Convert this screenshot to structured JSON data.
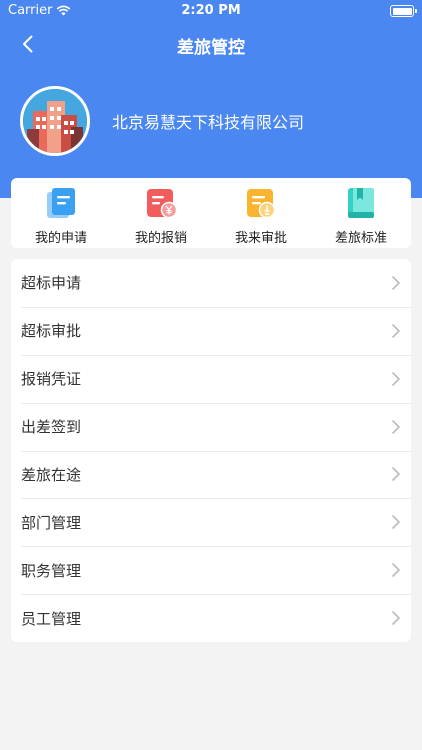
{
  "status_bar": {
    "carrier": "Carrier",
    "time": "2:20 PM"
  },
  "nav": {
    "title": "差旅管控"
  },
  "profile": {
    "company": "北京易慧天下科技有限公司"
  },
  "quick_actions": [
    {
      "label": "我的申请",
      "icon": "application-doc-icon",
      "color": "#3aa0f4"
    },
    {
      "label": "我的报销",
      "icon": "reimbursement-yuan-icon",
      "color": "#f25c5c"
    },
    {
      "label": "我来审批",
      "icon": "approval-doc-icon",
      "color": "#fbb42f"
    },
    {
      "label": "差旅标准",
      "icon": "standard-book-icon",
      "color": "#33d1c3"
    }
  ],
  "menu": [
    {
      "label": "超标申请"
    },
    {
      "label": "超标审批"
    },
    {
      "label": "报销凭证"
    },
    {
      "label": "出差签到"
    },
    {
      "label": "差旅在途"
    },
    {
      "label": "部门管理"
    },
    {
      "label": "职务管理"
    },
    {
      "label": "员工管理"
    }
  ],
  "colors": {
    "header": "#4a87f0",
    "background": "#f3f3f3",
    "card": "#ffffff"
  }
}
